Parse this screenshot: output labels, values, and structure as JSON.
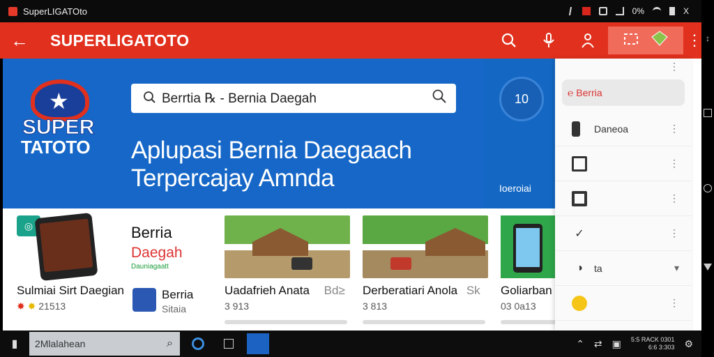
{
  "statusbar": {
    "title": "SuperLIGATOto",
    "percent": "0%",
    "close": "X"
  },
  "appbar": {
    "back": "←",
    "brand": "SUPERLIGATOTO"
  },
  "hero": {
    "logo_line1": "SUPER",
    "logo_line2": "TATOTO",
    "search_text": "Berrtia ℞ - Bernia Daegah",
    "tagline": "Aplupasi Bernia Daegaach Terpercajay Amnda"
  },
  "side_strip": {
    "dial": "10",
    "label": "Ioeroiai"
  },
  "cards": [
    {
      "title": "Sulmiai Sirt Daegian",
      "sub": "21513"
    },
    {
      "title": "Berria",
      "sub_red": "Daegah",
      "sub_green": "Dauniagaatt",
      "sub2": "Berria",
      "sub3": "Sitaia"
    },
    {
      "title": "Uadafrieh Anata",
      "extra": "Bd≥",
      "sub": "3 913"
    },
    {
      "title": "Derberatiari Anola",
      "extra": "Sk",
      "sub": "3 813"
    },
    {
      "title": "Goliarban",
      "sub": "03 0a13"
    }
  ],
  "menu": {
    "items": [
      {
        "label": "Berria"
      },
      {
        "label": "Daneoa"
      },
      {
        "label": ""
      },
      {
        "label": ""
      },
      {
        "label": ""
      },
      {
        "label": "ta"
      },
      {
        "label": ""
      }
    ]
  },
  "taskbar": {
    "search_text": "2Mlalahean",
    "clock_line1": "5:5 RACK 0301",
    "clock_line2": "6:6 3:303"
  }
}
